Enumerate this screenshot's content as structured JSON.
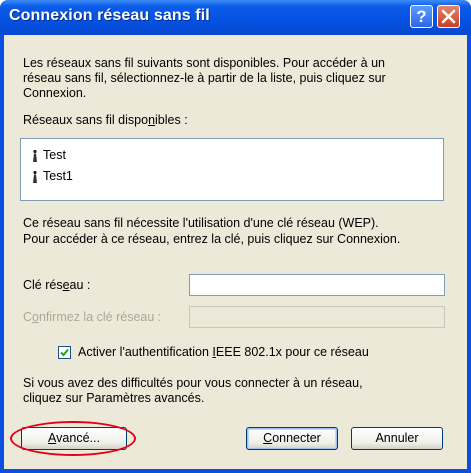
{
  "window": {
    "title": "Connexion réseau sans fil"
  },
  "controls": {
    "help": "?",
    "close": "×"
  },
  "intro": {
    "line1": "Les réseaux sans fil suivants sont disponibles. Pour accéder à un",
    "line2": "réseau sans fil, sélectionnez-le à partir de la liste, puis cliquez sur",
    "line3": "Connexion."
  },
  "networks_label": {
    "before": "Réseaux sans fil dispo",
    "underlined": "n",
    "after": "ibles :"
  },
  "networks": [
    {
      "name": "Test",
      "icon": "antenna-icon"
    },
    {
      "name": "Test1",
      "icon": "antenna-icon"
    }
  ],
  "key_notice": {
    "line1": "Ce réseau sans fil nécessite l'utilisation d'une clé réseau (WEP).",
    "line2": "Pour accéder à ce réseau, entrez la clé, puis cliquez sur Connexion."
  },
  "network_key": {
    "before": "Clé rés",
    "underlined": "e",
    "after": "au :",
    "value": ""
  },
  "confirm_key": {
    "before": "C",
    "underlined": "o",
    "after": "nfirmez la clé réseau :",
    "value": ""
  },
  "ieee": {
    "before": "Activer l'authentification ",
    "underlined": "I",
    "after": "EEE 802.1x pour ce réseau",
    "checked": true
  },
  "trouble": {
    "line1": "Si vous avez des difficultés pour vous connecter à un réseau,",
    "line2": "cliquez sur Paramètres avancés."
  },
  "buttons": {
    "advanced": {
      "underlined": "A",
      "after": "vancé..."
    },
    "connect": {
      "underlined": "C",
      "after": "onnecter"
    },
    "cancel": "Annuler"
  },
  "colors": {
    "title_bar": "#0651e3",
    "dialog_bg": "#ece9d8",
    "highlight": "#e5001a"
  }
}
